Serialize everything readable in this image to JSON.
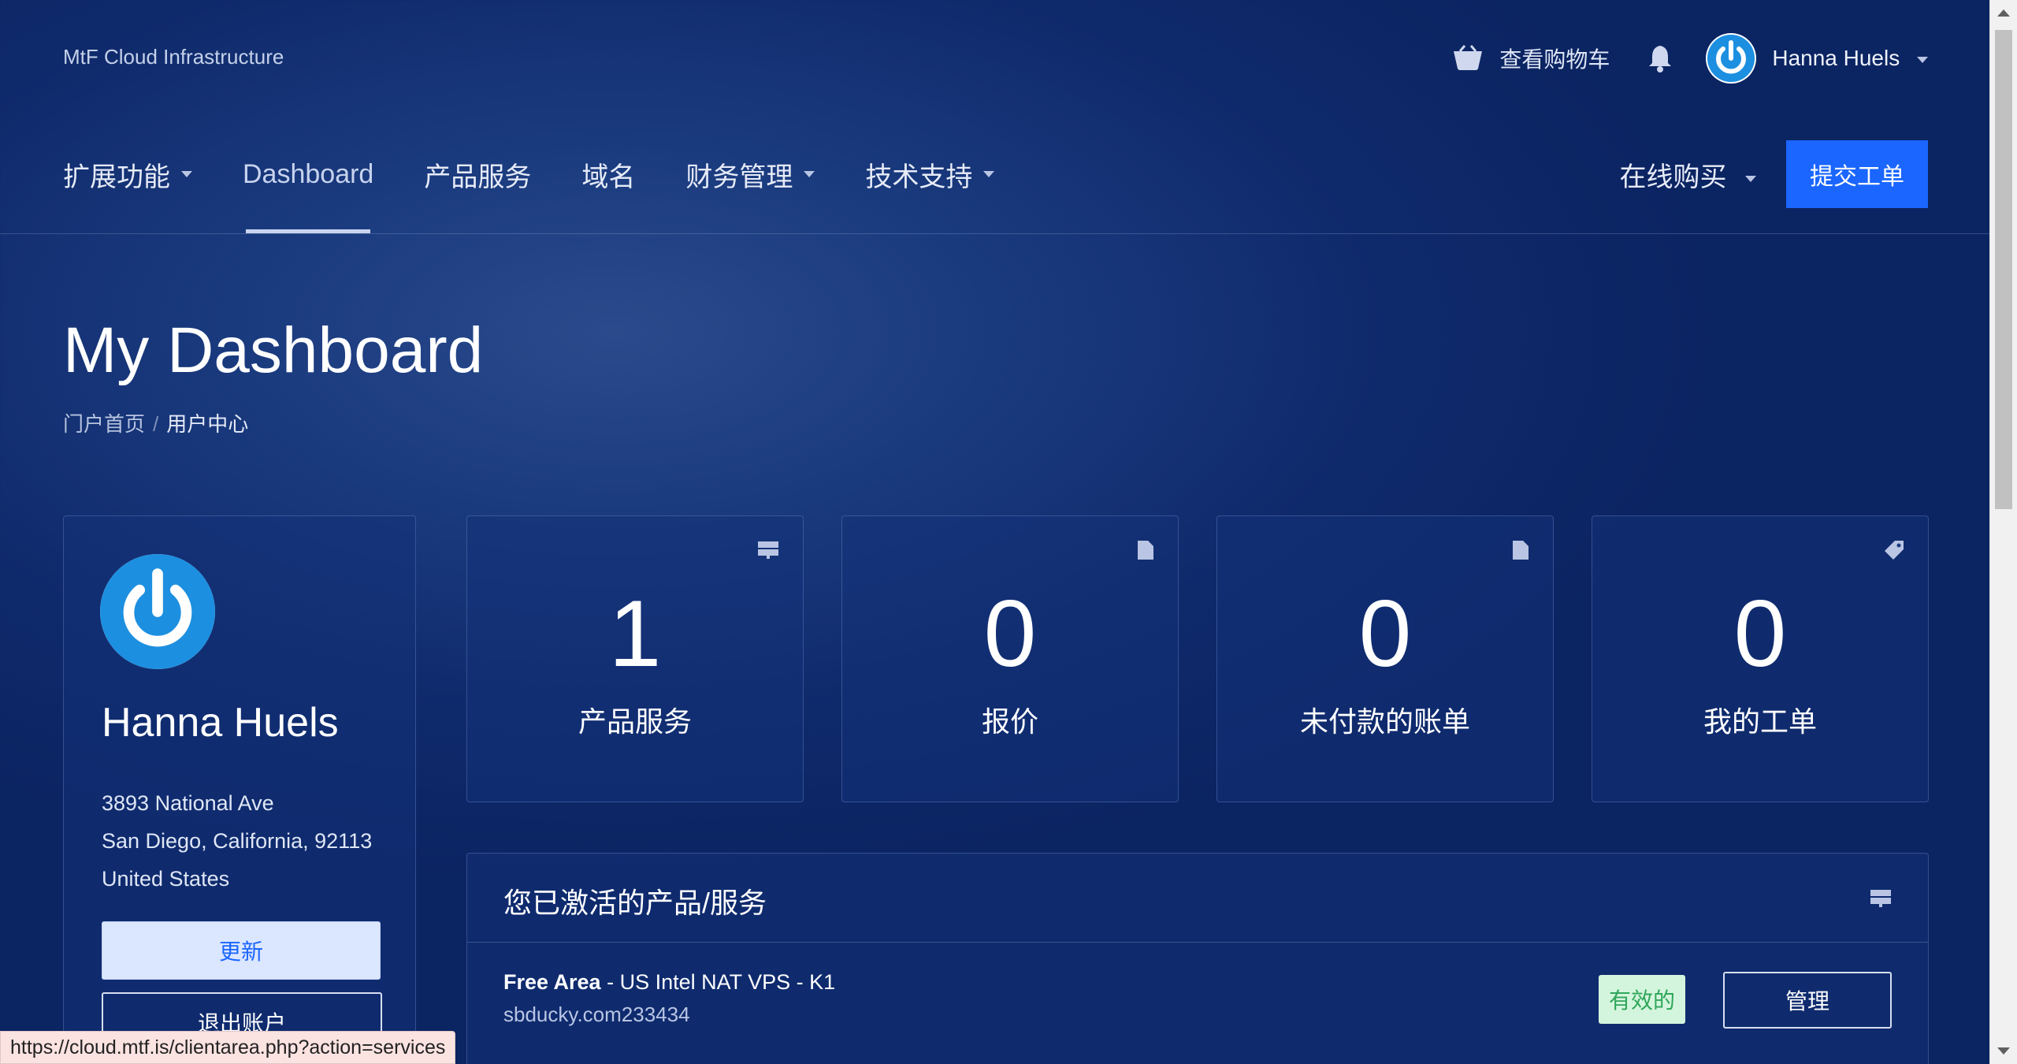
{
  "brand": "MtF Cloud Infrastructure",
  "topbar": {
    "cart_label": "查看购物车",
    "user_name": "Hanna Huels"
  },
  "nav": {
    "items": [
      "扩展功能",
      "Dashboard",
      "产品服务",
      "域名",
      "财务管理",
      "技术支持"
    ],
    "buy_online": "在线购买",
    "submit_ticket": "提交工单"
  },
  "page": {
    "title": "My Dashboard",
    "breadcrumb": [
      "门户首页",
      "用户中心"
    ]
  },
  "profile": {
    "name": "Hanna Huels",
    "address": [
      "3893 National Ave",
      "San Diego, California, 92113",
      "United States"
    ],
    "update_label": "更新",
    "logout_label": "退出账户"
  },
  "stats": [
    {
      "value": "1",
      "label": "产品服务",
      "icon": "server-icon"
    },
    {
      "value": "0",
      "label": "报价",
      "icon": "document-icon"
    },
    {
      "value": "0",
      "label": "未付款的账单",
      "icon": "document-icon"
    },
    {
      "value": "0",
      "label": "我的工单",
      "icon": "tag-icon"
    }
  ],
  "services": {
    "title": "您已激活的产品/服务",
    "rows": [
      {
        "group": "Free Area",
        "product": " - US Intel NAT VPS - K1",
        "domain": "sbducky.com233434",
        "status": "有效的",
        "action": "管理"
      }
    ]
  },
  "status_url": "https://cloud.mtf.is/clientarea.php?action=services",
  "colors": {
    "primary": "#1a66ff",
    "background": "#0f2a6b",
    "status_active_bg": "#d4f5dd",
    "status_active_text": "#2fa65a"
  }
}
